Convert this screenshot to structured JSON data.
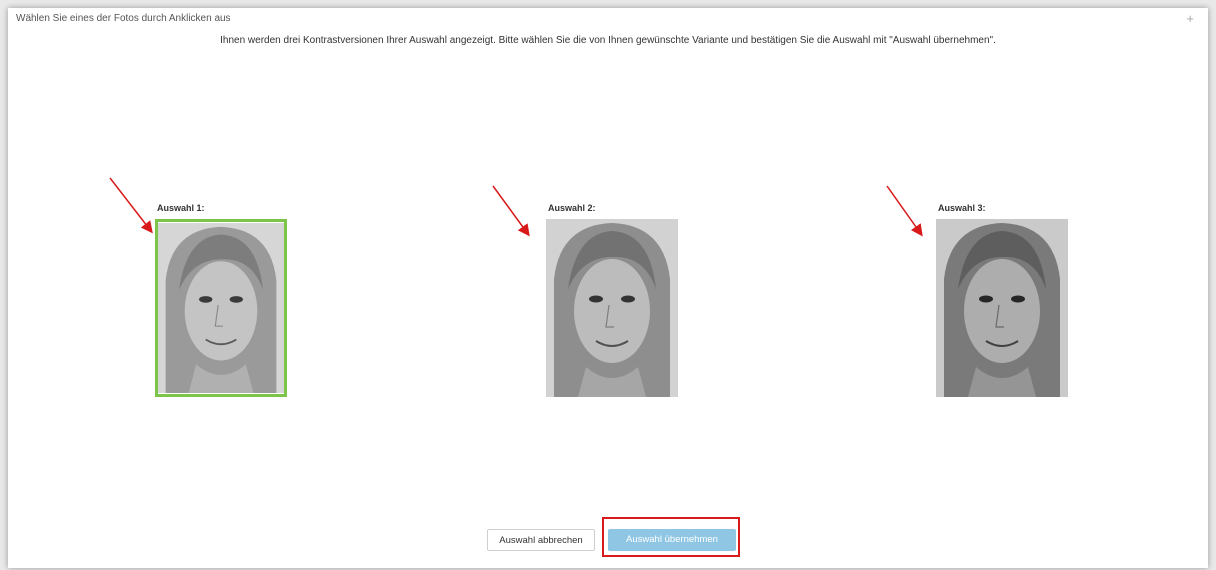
{
  "dialog": {
    "title": "Wählen Sie eines der Fotos durch Anklicken aus",
    "close_symbol": "+",
    "instruction": "Ihnen werden drei Kontrastversionen Ihrer Auswahl angezeigt. Bitte wählen Sie die von Ihnen gewünschte Variante und bestätigen Sie die Auswahl mit \"Auswahl übernehmen\"."
  },
  "choices": [
    {
      "label": "Auswahl 1:",
      "selected": true
    },
    {
      "label": "Auswahl 2:",
      "selected": false
    },
    {
      "label": "Auswahl 3:",
      "selected": false
    }
  ],
  "buttons": {
    "cancel": "Auswahl abbrechen",
    "accept": "Auswahl übernehmen"
  },
  "colors": {
    "selected_border": "#7cc548",
    "annotation_red": "#d91a1a",
    "accept_button": "#8fc6e4"
  }
}
